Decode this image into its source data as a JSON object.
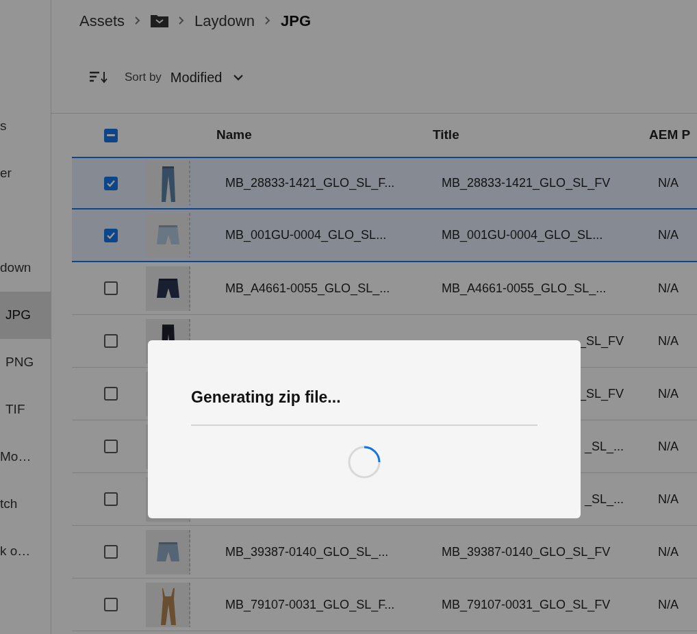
{
  "breadcrumb": {
    "items": [
      {
        "kind": "text",
        "label": "Assets"
      },
      {
        "kind": "folder"
      },
      {
        "kind": "text",
        "label": "Laydown"
      },
      {
        "kind": "current",
        "label": "JPG"
      }
    ]
  },
  "sidebar": {
    "items": [
      {
        "label": "s",
        "selected": false
      },
      {
        "label": "er",
        "selected": false
      },
      {
        "label": "down",
        "selected": false
      },
      {
        "label": "JPG",
        "selected": true
      },
      {
        "label": "PNG",
        "selected": false
      },
      {
        "label": "TIF",
        "selected": false
      },
      {
        "label": "Mo…",
        "selected": false
      },
      {
        "label": "tch",
        "selected": false
      },
      {
        "label": "k o…",
        "selected": false
      }
    ]
  },
  "sort": {
    "label": "Sort by",
    "value": "Modified"
  },
  "table": {
    "select_all_indeterminate": true,
    "columns": [
      "Name",
      "Title",
      "AEM P"
    ],
    "rows": [
      {
        "selected": true,
        "name": "MB_28833-1421_GLO_SL_F...",
        "title": "MB_28833-1421_GLO_SL_FV",
        "column_3": "N/A"
      },
      {
        "selected": true,
        "name": "MB_001GU-0004_GLO_SL...",
        "title": "MB_001GU-0004_GLO_SL...",
        "column_3": "N/A"
      },
      {
        "selected": false,
        "name": "MB_A4661-0055_GLO_SL_...",
        "title": "MB_A4661-0055_GLO_SL_...",
        "column_3": "N/A"
      },
      {
        "selected": false,
        "title": "_SL_FV",
        "column_3": "N/A"
      },
      {
        "selected": false,
        "title": "_SL_FV",
        "column_3": "N/A"
      },
      {
        "selected": false,
        "title": "_SL_...",
        "column_3": "N/A"
      },
      {
        "selected": false,
        "title": "_SL_...",
        "column_3": "N/A"
      },
      {
        "selected": false,
        "name": "MB_39387-0140_GLO_SL_...",
        "title": "MB_39387-0140_GLO_SL_FV",
        "column_3": "N/A"
      },
      {
        "selected": false,
        "name": "MB_79107-0031_GLO_SL_F...",
        "title": "MB_79107-0031_GLO_SL_FV",
        "column_3": "N/A"
      }
    ]
  },
  "dialog": {
    "title": "Generating zip file..."
  }
}
